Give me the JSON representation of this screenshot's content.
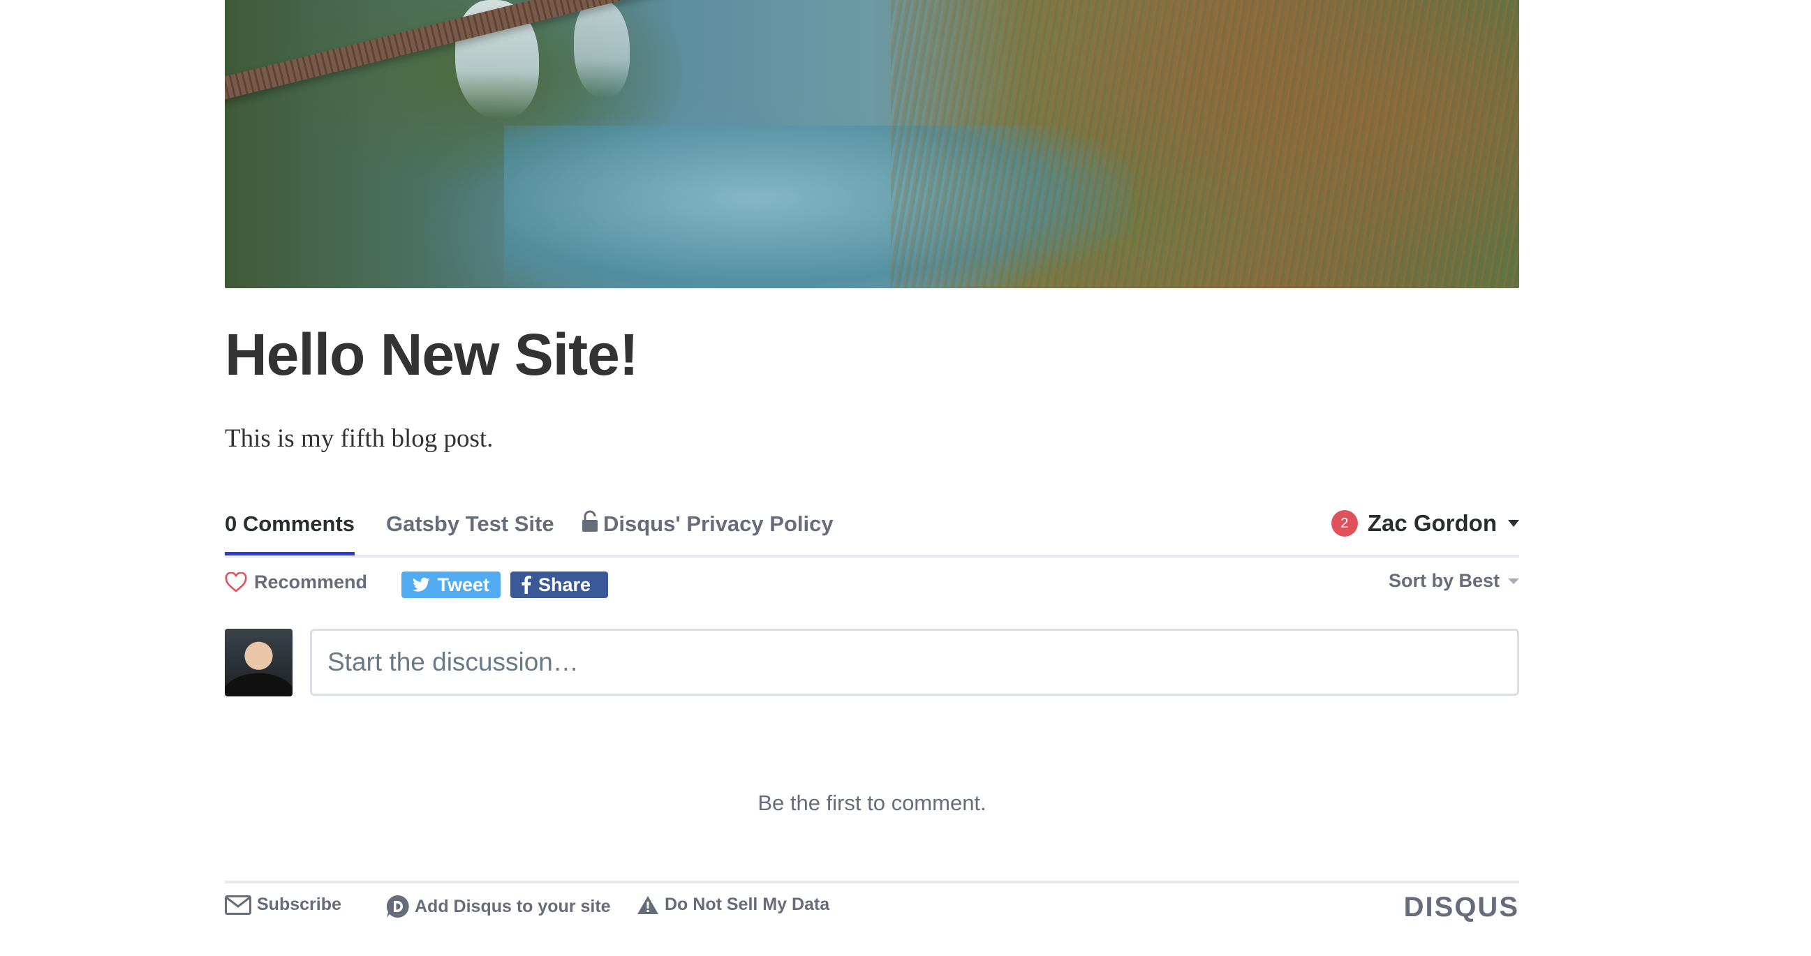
{
  "post": {
    "title": "Hello New Site!",
    "body": "This is my fifth blog post."
  },
  "hero": {
    "alt": "Aerial photo of a boardwalk over turquoise water and reeds"
  },
  "disqus": {
    "nav": {
      "comments_tab": "0 Comments",
      "site_tab": "Gatsby Test Site",
      "privacy_tab": "Disqus' Privacy Policy",
      "user_name": "Zac Gordon",
      "notification_count": "2"
    },
    "actions": {
      "recommend": "Recommend",
      "tweet": "Tweet",
      "share": "Share",
      "sort": "Sort by Best"
    },
    "compose": {
      "placeholder": "Start the discussion…"
    },
    "empty_message": "Be the first to comment.",
    "footer": {
      "subscribe": "Subscribe",
      "add_disqus": "Add Disqus to your site",
      "do_not_sell": "Do Not Sell My Data",
      "logo": "DISQUS"
    },
    "colors": {
      "accent": "#2e3ec9",
      "tweet": "#50abf1",
      "facebook": "#3b5998",
      "badge": "#e0525b",
      "muted": "#656c7a"
    },
    "icons": [
      "lock-icon",
      "caret-down-icon",
      "heart-icon",
      "twitter-icon",
      "facebook-icon",
      "envelope-icon",
      "disqus-d-icon",
      "warning-icon"
    ]
  }
}
